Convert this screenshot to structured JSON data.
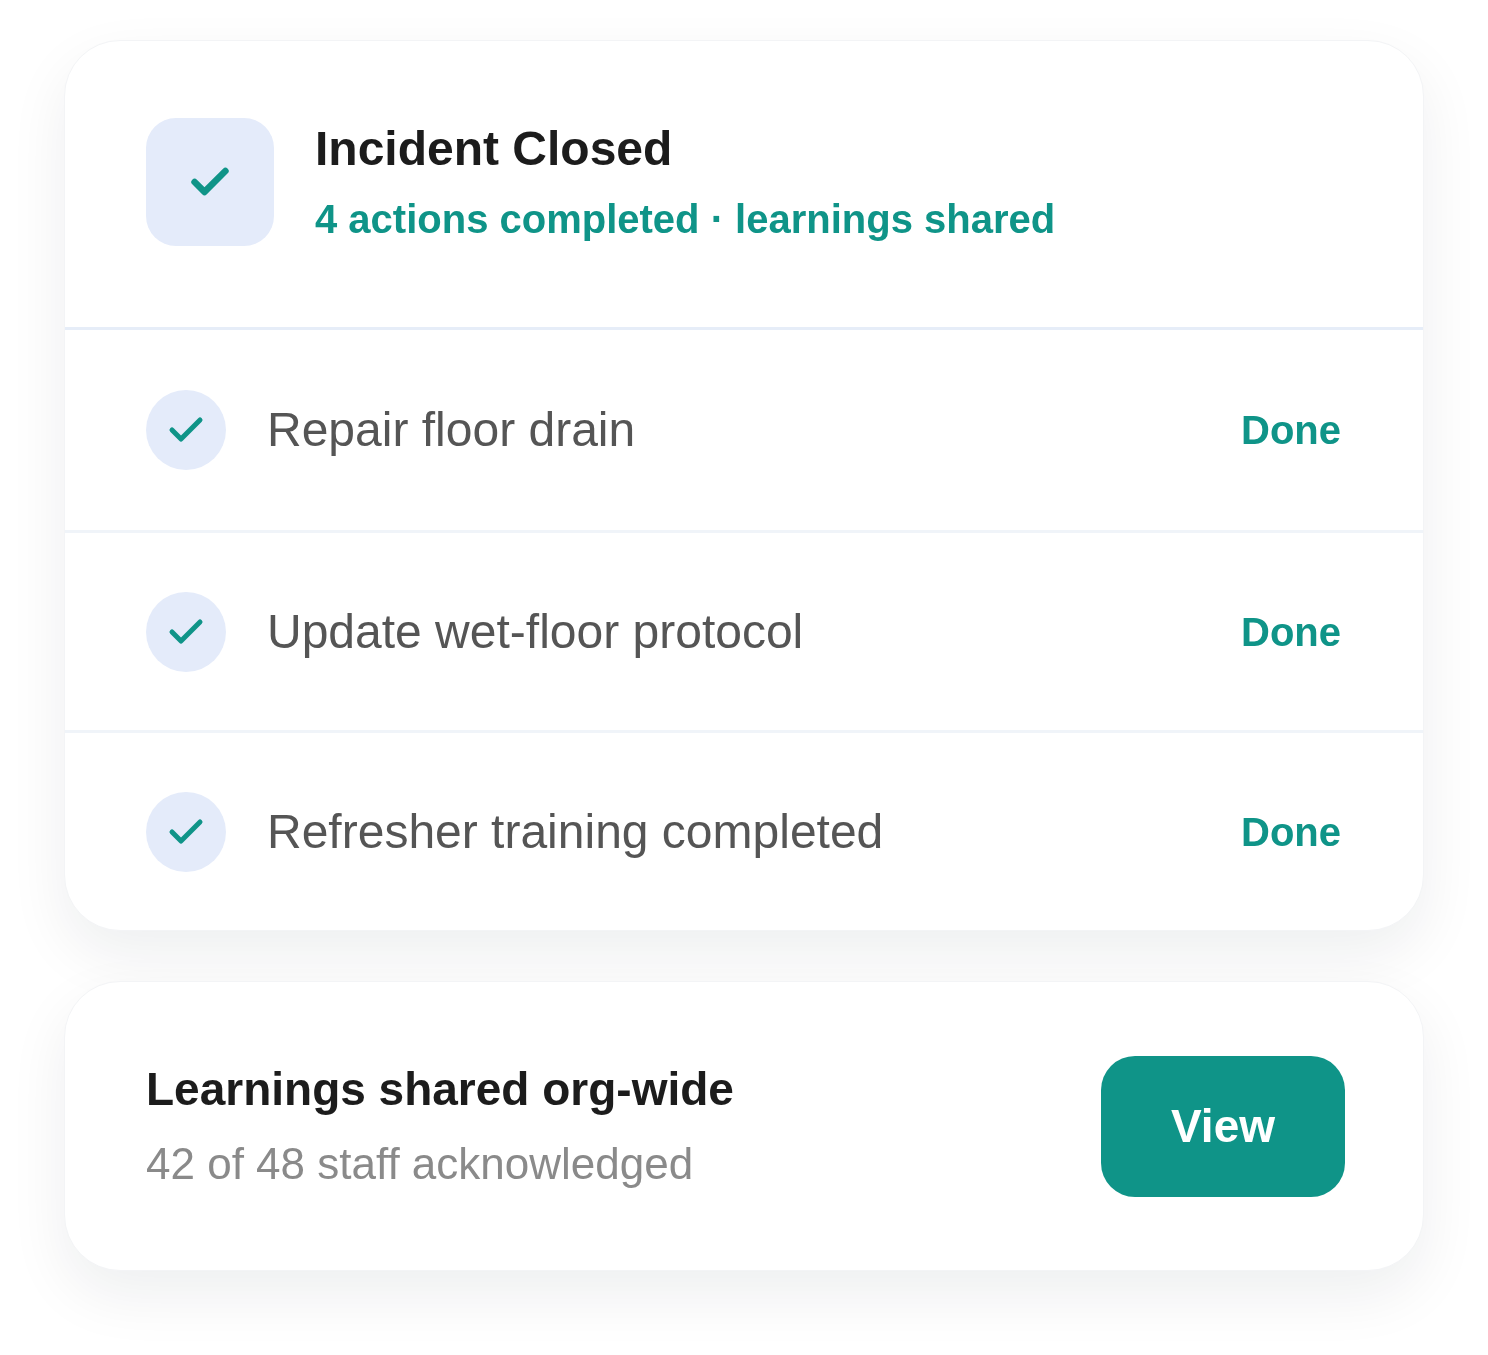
{
  "incident": {
    "title": "Incident Closed",
    "subtitle": "4 actions completed · learnings shared",
    "closed": true
  },
  "actions": [
    {
      "label": "Repair floor drain",
      "status": "Done",
      "checked": true
    },
    {
      "label": "Update wet-floor protocol",
      "status": "Done",
      "checked": true
    },
    {
      "label": "Refresher training completed",
      "status": "Done",
      "checked": true
    }
  ],
  "learnings": {
    "title": "Learnings shared org-wide",
    "subtitle": "42 of 48 staff acknowledged",
    "button": "View"
  }
}
